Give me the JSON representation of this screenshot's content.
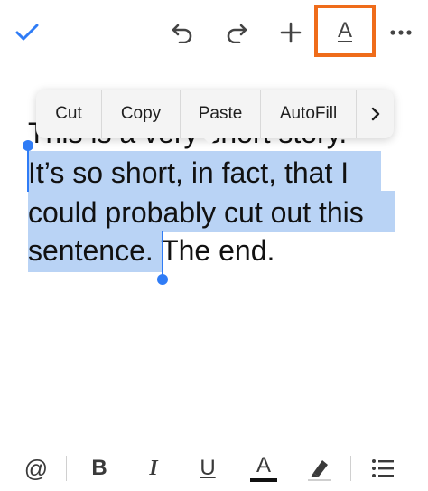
{
  "toolbar": {
    "done": "checkmark-icon",
    "undo": "undo-icon",
    "redo": "redo-icon",
    "insert": "plus-icon",
    "format_label": "A",
    "more": "more-icon",
    "accent_color": "#2f7cf6",
    "format_highlight_color": "#ef6c1a"
  },
  "document": {
    "lines": [
      "This is a very short story.",
      "It’s so short, in fact, that I",
      "could probably cut out this",
      "sentence.",
      " The end."
    ],
    "selection_color": "#b9d3f5"
  },
  "edit_menu": {
    "items": [
      "Cut",
      "Copy",
      "Paste",
      "AutoFill"
    ],
    "more_label": "›"
  },
  "format_bar": {
    "mention_label": "@",
    "bold_label": "B",
    "italic_label": "I",
    "underline_label": "U",
    "text_color_label": "A",
    "highlight": "highlighter-icon",
    "list": "bulleted-list-icon"
  }
}
